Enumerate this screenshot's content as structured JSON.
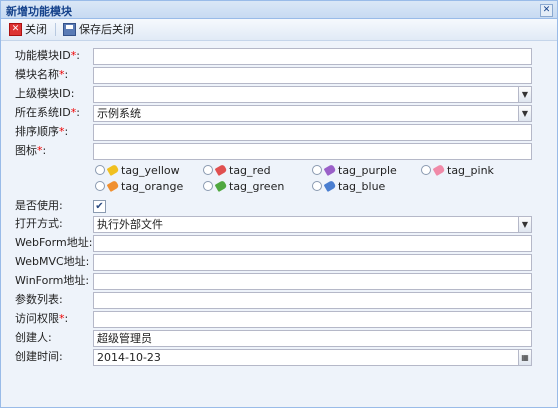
{
  "window": {
    "title": "新增功能模块"
  },
  "toolbar": {
    "close_label": "关闭",
    "save_close_label": "保存后关闭"
  },
  "form": {
    "module_id": {
      "label": "功能模块ID",
      "req": "*",
      "colon": ":",
      "value": ""
    },
    "module_name": {
      "label": "模块名称",
      "req": "*",
      "colon": ":",
      "value": ""
    },
    "parent_id": {
      "label": "上级模块ID:",
      "value": ""
    },
    "system_id": {
      "label": "所在系统ID",
      "req": "*",
      "colon": ":",
      "value": "示例系统"
    },
    "sort_order": {
      "label": "排序顺序",
      "req": "*",
      "colon": ":",
      "value": ""
    },
    "icon": {
      "label": "图标",
      "req": "*",
      "colon": ":",
      "value": ""
    },
    "icon_options": [
      {
        "label": "tag_yellow",
        "color": "#f0c020"
      },
      {
        "label": "tag_red",
        "color": "#e05050"
      },
      {
        "label": "tag_purple",
        "color": "#9a60c8"
      },
      {
        "label": "tag_pink",
        "color": "#f08aa8"
      },
      {
        "label": "tag_orange",
        "color": "#f09030"
      },
      {
        "label": "tag_green",
        "color": "#50a840"
      },
      {
        "label": "tag_blue",
        "color": "#4a7ed0"
      }
    ],
    "enabled": {
      "label": "是否使用:",
      "checked": true
    },
    "open_mode": {
      "label": "打开方式:",
      "value": "执行外部文件"
    },
    "webform_url": {
      "label": "WebForm地址:",
      "value": ""
    },
    "webmvc_url": {
      "label": "WebMVC地址:",
      "value": ""
    },
    "winform_url": {
      "label": "WinForm地址:",
      "value": ""
    },
    "params": {
      "label": "参数列表:",
      "value": ""
    },
    "access": {
      "label": "访问权限",
      "req": "*",
      "colon": ":",
      "value": ""
    },
    "creator": {
      "label": "创建人:",
      "value": "超级管理员"
    },
    "created_at": {
      "label": "创建时间:",
      "value": "2014-10-23"
    }
  }
}
